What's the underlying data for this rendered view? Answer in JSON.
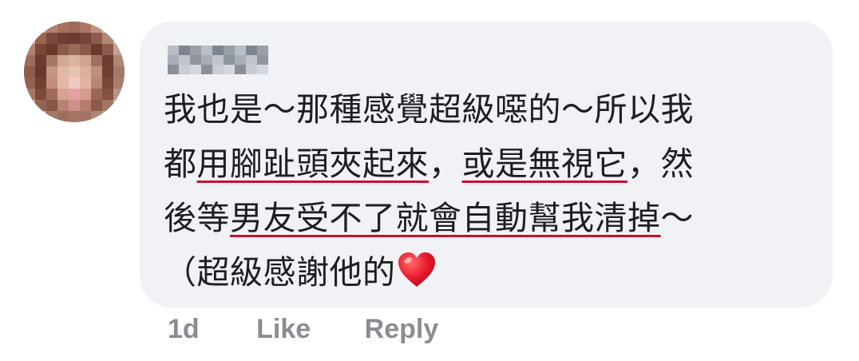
{
  "comment": {
    "author_name": "",
    "lines": [
      [
        {
          "text": "我也是～那種感覺超級噁的～所以我",
          "underline": false
        }
      ],
      [
        {
          "text": "都",
          "underline": false
        },
        {
          "text": "用腳趾頭夾起來",
          "underline": true
        },
        {
          "text": "，",
          "underline": false
        },
        {
          "text": "或是無視它",
          "underline": true
        },
        {
          "text": "，然",
          "underline": false
        }
      ],
      [
        {
          "text": "後等",
          "underline": false
        },
        {
          "text": "男友受不了就會自動幫我清掉",
          "underline": true
        },
        {
          "text": "～",
          "underline": false
        }
      ],
      [
        {
          "text": "（超級感謝他的",
          "underline": false
        }
      ]
    ],
    "emoji": "heart-emoji"
  },
  "actions": {
    "time": "1d",
    "like_label": "Like",
    "reply_label": "Reply"
  },
  "colors": {
    "bubble": "#f0f2f5",
    "text": "#1c1e21",
    "meta": "#8a8d91",
    "underline": "#c8102e",
    "heart": "#e8192c"
  }
}
